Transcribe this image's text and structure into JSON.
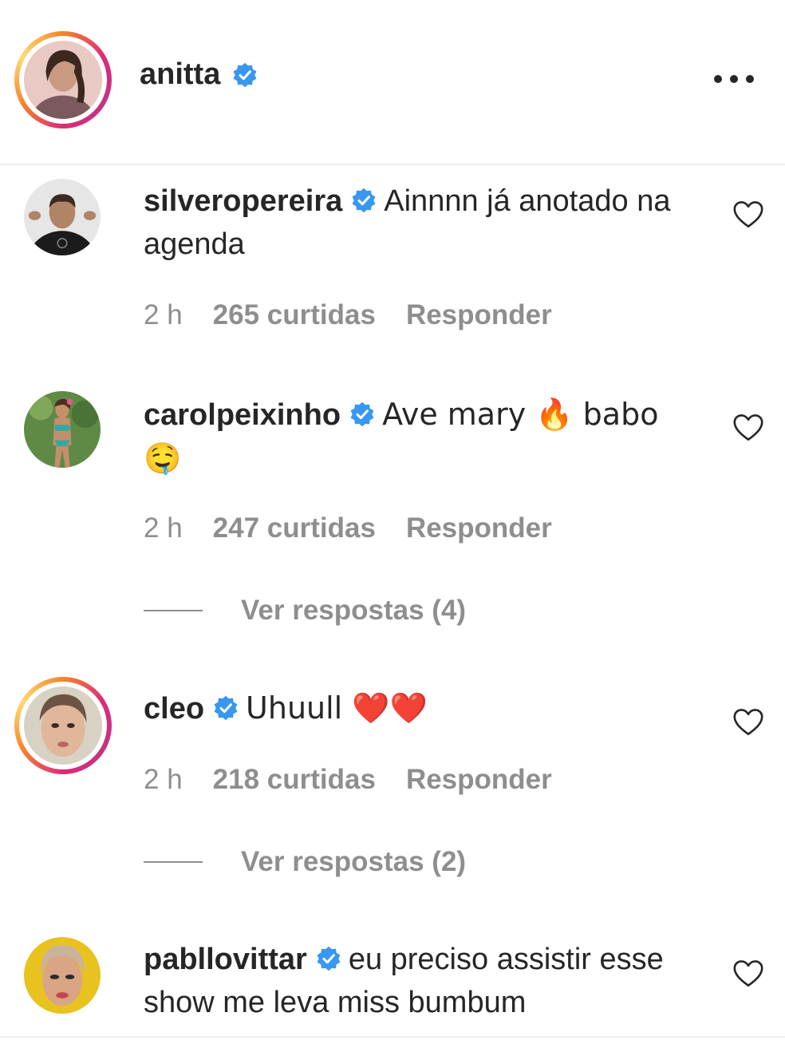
{
  "post": {
    "author": "anitta"
  },
  "comments": [
    {
      "user": "silveropereira",
      "text": "Ainnnn já anotado na agenda",
      "time": "2 h",
      "likes": "265 curtidas",
      "reply": "Responder"
    },
    {
      "user": "carolpeixinho",
      "text": "Ave mary 🔥 babo 🤤",
      "time": "2 h",
      "likes": "247 curtidas",
      "reply": "Responder",
      "view_replies": "Ver respostas (4)"
    },
    {
      "user": "cleo",
      "text": "Uhuull ❤️❤️",
      "time": "2 h",
      "likes": "218 curtidas",
      "reply": "Responder",
      "view_replies": "Ver respostas (2)"
    },
    {
      "user": "pabllovittar",
      "text": "eu preciso assistir esse show me leva miss bumbum"
    }
  ],
  "icons": {
    "verified": "verified-badge-icon",
    "more": "more-options-icon",
    "like": "heart-outline-icon"
  },
  "colors": {
    "verified": "#3897f0",
    "text": "#262626",
    "muted": "#8e8e8e"
  }
}
